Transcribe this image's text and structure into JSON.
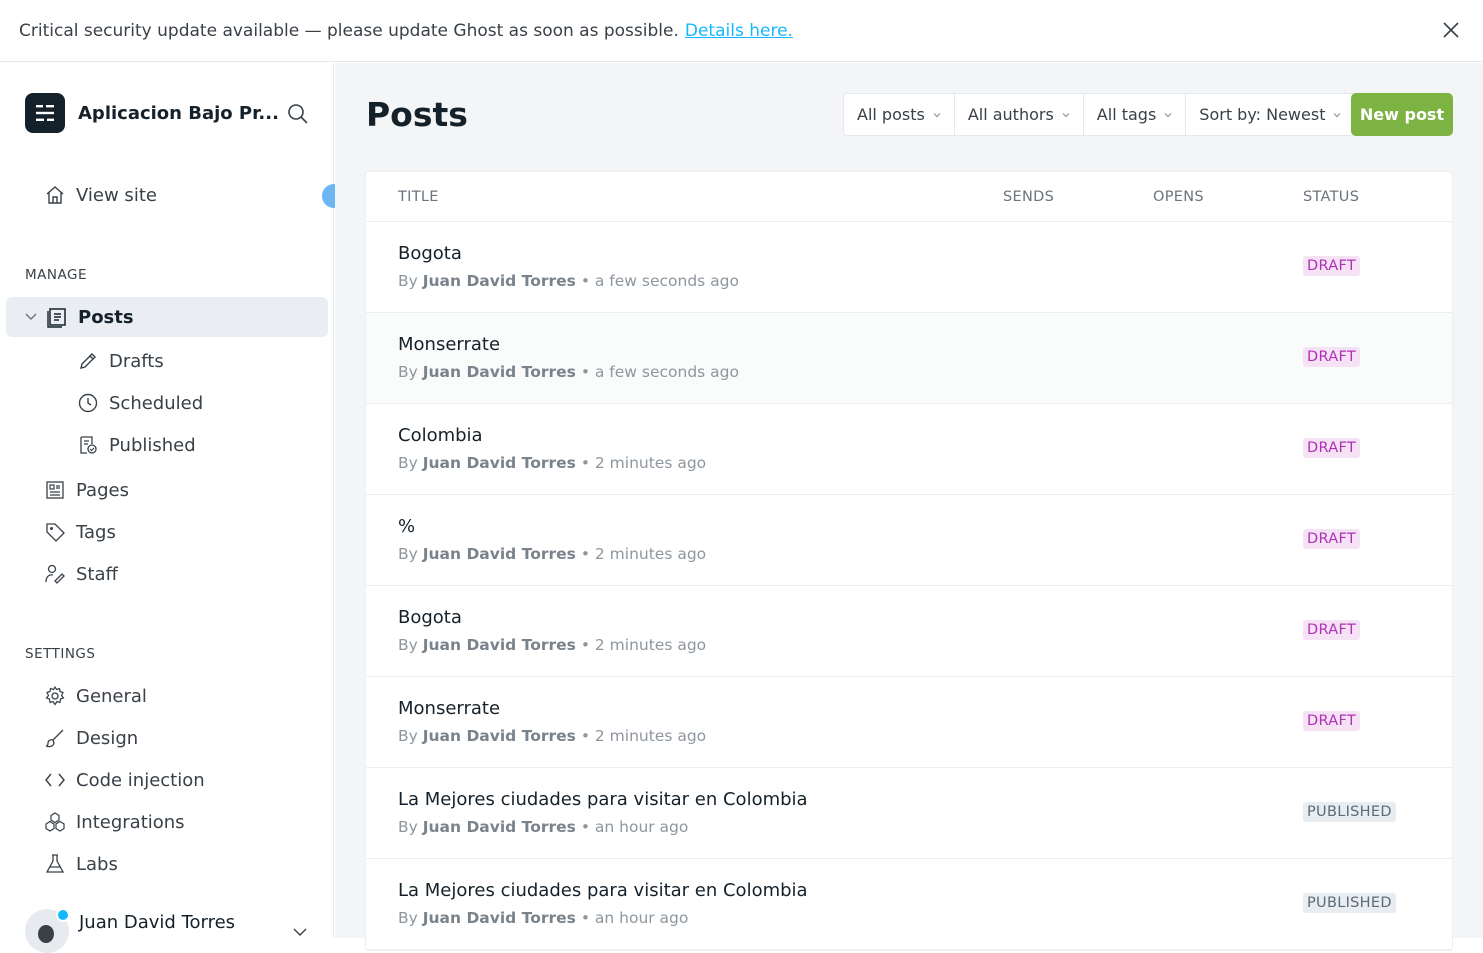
{
  "banner": {
    "message": "Critical security update available — please update Ghost as soon as possible.",
    "link": "Details here."
  },
  "sidebar": {
    "brand": "Aplicacion Bajo Pr...",
    "view_site": "View site",
    "manage_label": "MANAGE",
    "posts": "Posts",
    "drafts": "Drafts",
    "scheduled": "Scheduled",
    "published": "Published",
    "pages": "Pages",
    "tags": "Tags",
    "staff": "Staff",
    "settings_label": "SETTINGS",
    "general": "General",
    "design": "Design",
    "code_injection": "Code injection",
    "integrations": "Integrations",
    "labs": "Labs",
    "user_name": "Juan David Torres"
  },
  "main": {
    "title": "Posts",
    "filters": {
      "posts": "All posts",
      "authors": "All authors",
      "tags": "All tags",
      "sort": "Sort by: Newest"
    },
    "new_post": "New post",
    "columns": {
      "title": "TITLE",
      "sends": "SENDS",
      "opens": "OPENS",
      "status": "STATUS"
    },
    "rows": [
      {
        "title": "Bogota",
        "by": "By",
        "author": "Juan David Torres",
        "time": "• a few seconds ago",
        "status": "DRAFT"
      },
      {
        "title": "Monserrate",
        "by": "By",
        "author": "Juan David Torres",
        "time": "• a few seconds ago",
        "status": "DRAFT"
      },
      {
        "title": "Colombia",
        "by": "By",
        "author": "Juan David Torres",
        "time": "• 2 minutes ago",
        "status": "DRAFT"
      },
      {
        "title": "%",
        "by": "By",
        "author": "Juan David Torres",
        "time": "• 2 minutes ago",
        "status": "DRAFT"
      },
      {
        "title": "Bogota",
        "by": "By",
        "author": "Juan David Torres",
        "time": "• 2 minutes ago",
        "status": "DRAFT"
      },
      {
        "title": "Monserrate",
        "by": "By",
        "author": "Juan David Torres",
        "time": "• 2 minutes ago",
        "status": "DRAFT"
      },
      {
        "title": "La Mejores ciudades para visitar en Colombia",
        "by": "By",
        "author": "Juan David Torres",
        "time": "• an hour ago",
        "status": "PUBLISHED"
      },
      {
        "title": "La Mejores ciudades para visitar en Colombia",
        "by": "By",
        "author": "Juan David Torres",
        "time": "• an hour ago",
        "status": "PUBLISHED"
      }
    ]
  },
  "colors": {
    "accent_green": "#7cb342",
    "link_blue": "#14b8ff",
    "draft_text": "#b12fb8",
    "draft_bg": "#f5e3f5"
  }
}
